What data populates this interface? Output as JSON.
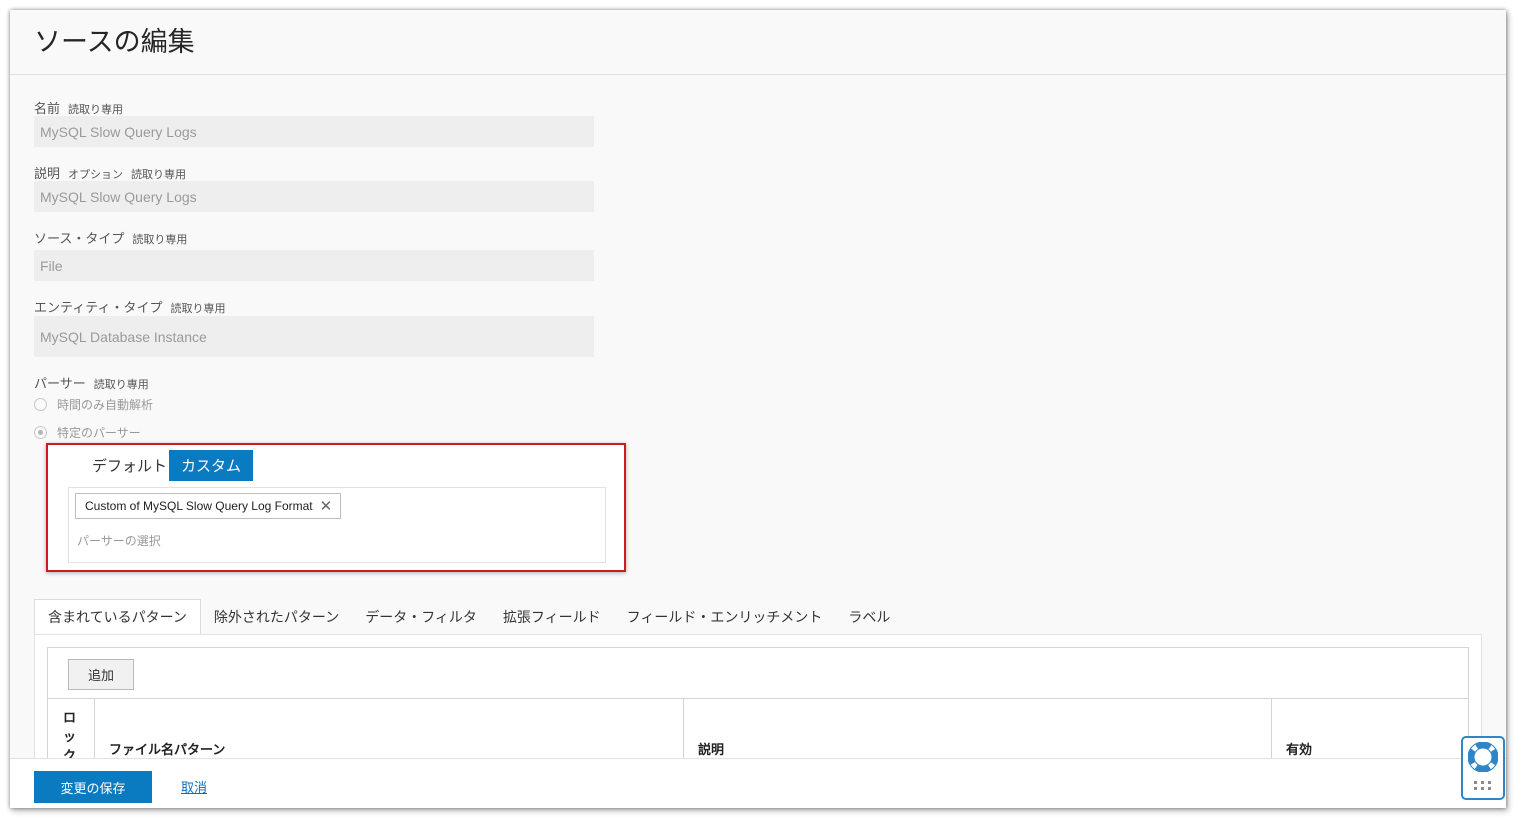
{
  "header": {
    "title": "ソースの編集"
  },
  "fields": {
    "name": {
      "label": "名前",
      "tag": "読取り専用",
      "value": "MySQL Slow Query Logs"
    },
    "description": {
      "label": "説明",
      "tag_optional": "オプション",
      "tag": "読取り専用",
      "value": "MySQL Slow Query Logs"
    },
    "source_type": {
      "label": "ソース・タイプ",
      "tag": "読取り専用",
      "value": "File"
    },
    "entity_type": {
      "label": "エンティティ・タイプ",
      "tag": "読取り専用",
      "value": "MySQL Database Instance"
    }
  },
  "parser": {
    "label": "パーサー",
    "tag": "読取り専用",
    "options": [
      {
        "label": "時間のみ自動解析",
        "checked": false
      },
      {
        "label": "特定のパーサー",
        "checked": true
      }
    ],
    "segments": {
      "default_label": "デフォルト",
      "custom_label": "カスタム",
      "selected": "custom"
    },
    "selected_chip": "Custom of MySQL Slow Query Log Format",
    "placeholder": "パーサーの選択",
    "highlight_color": "#d0191f"
  },
  "tabs": [
    {
      "label": "含まれているパターン",
      "active": true
    },
    {
      "label": "除外されたパターン",
      "active": false
    },
    {
      "label": "データ・フィルタ",
      "active": false
    },
    {
      "label": "拡張フィールド",
      "active": false
    },
    {
      "label": "フィールド・エンリッチメント",
      "active": false
    },
    {
      "label": "ラベル",
      "active": false
    }
  ],
  "table": {
    "add_label": "追加",
    "columns": {
      "lock": "ロック",
      "file_pattern": "ファイル名パターン",
      "description": "説明",
      "enabled": "有効"
    }
  },
  "footer": {
    "save_label": "変更の保存",
    "cancel_label": "取消"
  },
  "colors": {
    "primary": "#0a7bc1",
    "link": "#0a6ebd",
    "help_border": "#2e86c9"
  },
  "icons": {
    "chip_remove": "close-icon",
    "help": "lifebuoy-icon",
    "drag": "grip-icon"
  }
}
